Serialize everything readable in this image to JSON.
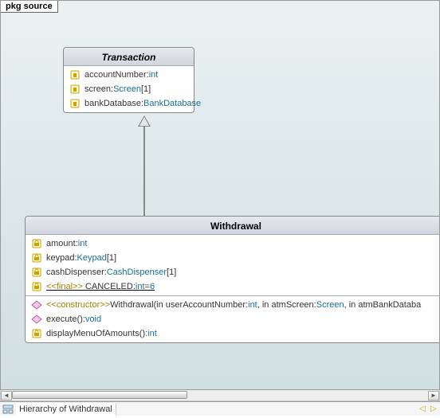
{
  "package_label": "pkg source",
  "transaction": {
    "title": "Transaction",
    "attrs": [
      {
        "name": "accountNumber",
        "type": "int"
      },
      {
        "name": "screen",
        "type": "Screen",
        "mult": "[1]"
      },
      {
        "name": "bankDatabase",
        "type": "BankDatabase"
      }
    ]
  },
  "withdrawal": {
    "title": "Withdrawal",
    "attrs": [
      {
        "name": "amount",
        "type": "int"
      },
      {
        "name": "keypad",
        "type": "Keypad",
        "mult": "[1]"
      },
      {
        "name": "cashDispenser",
        "type": "CashDispenser",
        "mult": "[1]"
      },
      {
        "stereo": "<<final>>",
        "name": "CANCELED",
        "type": "int",
        "value": "6",
        "static": true
      }
    ],
    "ops": [
      {
        "stereo": "<<constructor>>",
        "sig_prefix": "Withdrawal(in userAccountNumber:",
        "p1type": "int",
        "mid": ", in atmScreen:",
        "p2type": "Screen",
        "suffix": ", in atmBankDataba",
        "vis": "public"
      },
      {
        "name": "execute()",
        "ret": "void",
        "vis": "public"
      },
      {
        "name": "displayMenuOfAmounts()",
        "ret": "int",
        "vis": "private"
      }
    ]
  },
  "bottom_tab": "Hierarchy of Withdrawal"
}
